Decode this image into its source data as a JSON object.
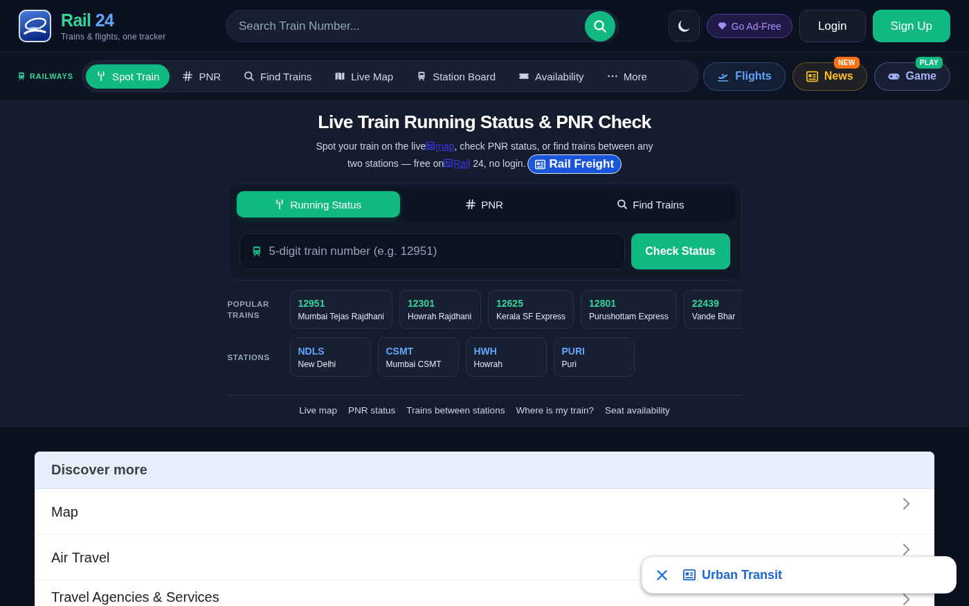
{
  "header": {
    "brand": {
      "name": "Rail",
      "number": "24"
    },
    "tagline": "Trains & flights, one tracker",
    "search": {
      "placeholder": "Search Train Number..."
    },
    "actions": {
      "ad_free": "Go Ad-Free",
      "login": "Login",
      "sign_up": "Sign Up"
    }
  },
  "nav": {
    "section_label": "RAILWAYS",
    "items": [
      {
        "label": "Spot Train",
        "selected": true
      },
      {
        "label": "PNR",
        "selected": false
      },
      {
        "label": "Find Trains",
        "selected": false
      },
      {
        "label": "Live Map",
        "selected": false
      },
      {
        "label": "Station Board",
        "selected": false
      },
      {
        "label": "Availability",
        "selected": false
      },
      {
        "label": "More",
        "selected": false
      }
    ],
    "quick_buttons": [
      {
        "label": "Flights",
        "color": "#60a5fa"
      },
      {
        "label": "News",
        "color": "#fbbf24",
        "badge": {
          "text": "NEW",
          "color": "#f97316"
        }
      },
      {
        "label": "Game",
        "color": "#a5b4fc",
        "badge": {
          "text": "PLAY",
          "color": "#10b981"
        }
      }
    ]
  },
  "hero": {
    "title": "Live Train Running Status & PNR Check",
    "subtitle": [
      {
        "kind": "text",
        "text": "Spot your train on the live"
      },
      {
        "kind": "link",
        "text": "map"
      },
      {
        "kind": "text",
        "text": ", check PNR status, or find trains between any two stations — free on"
      },
      {
        "kind": "link",
        "text": "Rail"
      },
      {
        "kind": "text",
        "text": " 24, no login."
      },
      {
        "kind": "chip",
        "text": "Rail Freight"
      }
    ]
  },
  "search_card": {
    "tabs": [
      {
        "label": "Running Status",
        "selected": true
      },
      {
        "label": "PNR",
        "selected": false
      },
      {
        "label": "Find Trains",
        "selected": false
      }
    ],
    "input": {
      "placeholder": "5-digit train number (e.g. 12951)"
    },
    "submit": "Check Status"
  },
  "popular_trains": {
    "label": "POPULAR TRAINS",
    "items": [
      {
        "number": "12951",
        "name": "Mumbai Tejas Rajdhani"
      },
      {
        "number": "12301",
        "name": "Howrah Rajdhani"
      },
      {
        "number": "12625",
        "name": "Kerala SF Express"
      },
      {
        "number": "12801",
        "name": "Purushottam Express"
      },
      {
        "number": "22439",
        "name": "Vande Bhar"
      }
    ]
  },
  "stations": {
    "label": "STATIONS",
    "items": [
      {
        "code": "NDLS",
        "name": "New Delhi"
      },
      {
        "code": "CSMT",
        "name": "Mumbai CSMT"
      },
      {
        "code": "HWH",
        "name": "Howrah"
      },
      {
        "code": "PURI",
        "name": "Puri"
      }
    ]
  },
  "quick_links": [
    "Live map",
    "PNR status",
    "Trains between stations",
    "Where is my train?",
    "Seat availability"
  ],
  "discover": {
    "title": "Discover more",
    "items": [
      "Map",
      "Air Travel",
      "Travel Agencies & Services"
    ]
  },
  "promo_bar": {
    "label": "Urban Transit"
  }
}
